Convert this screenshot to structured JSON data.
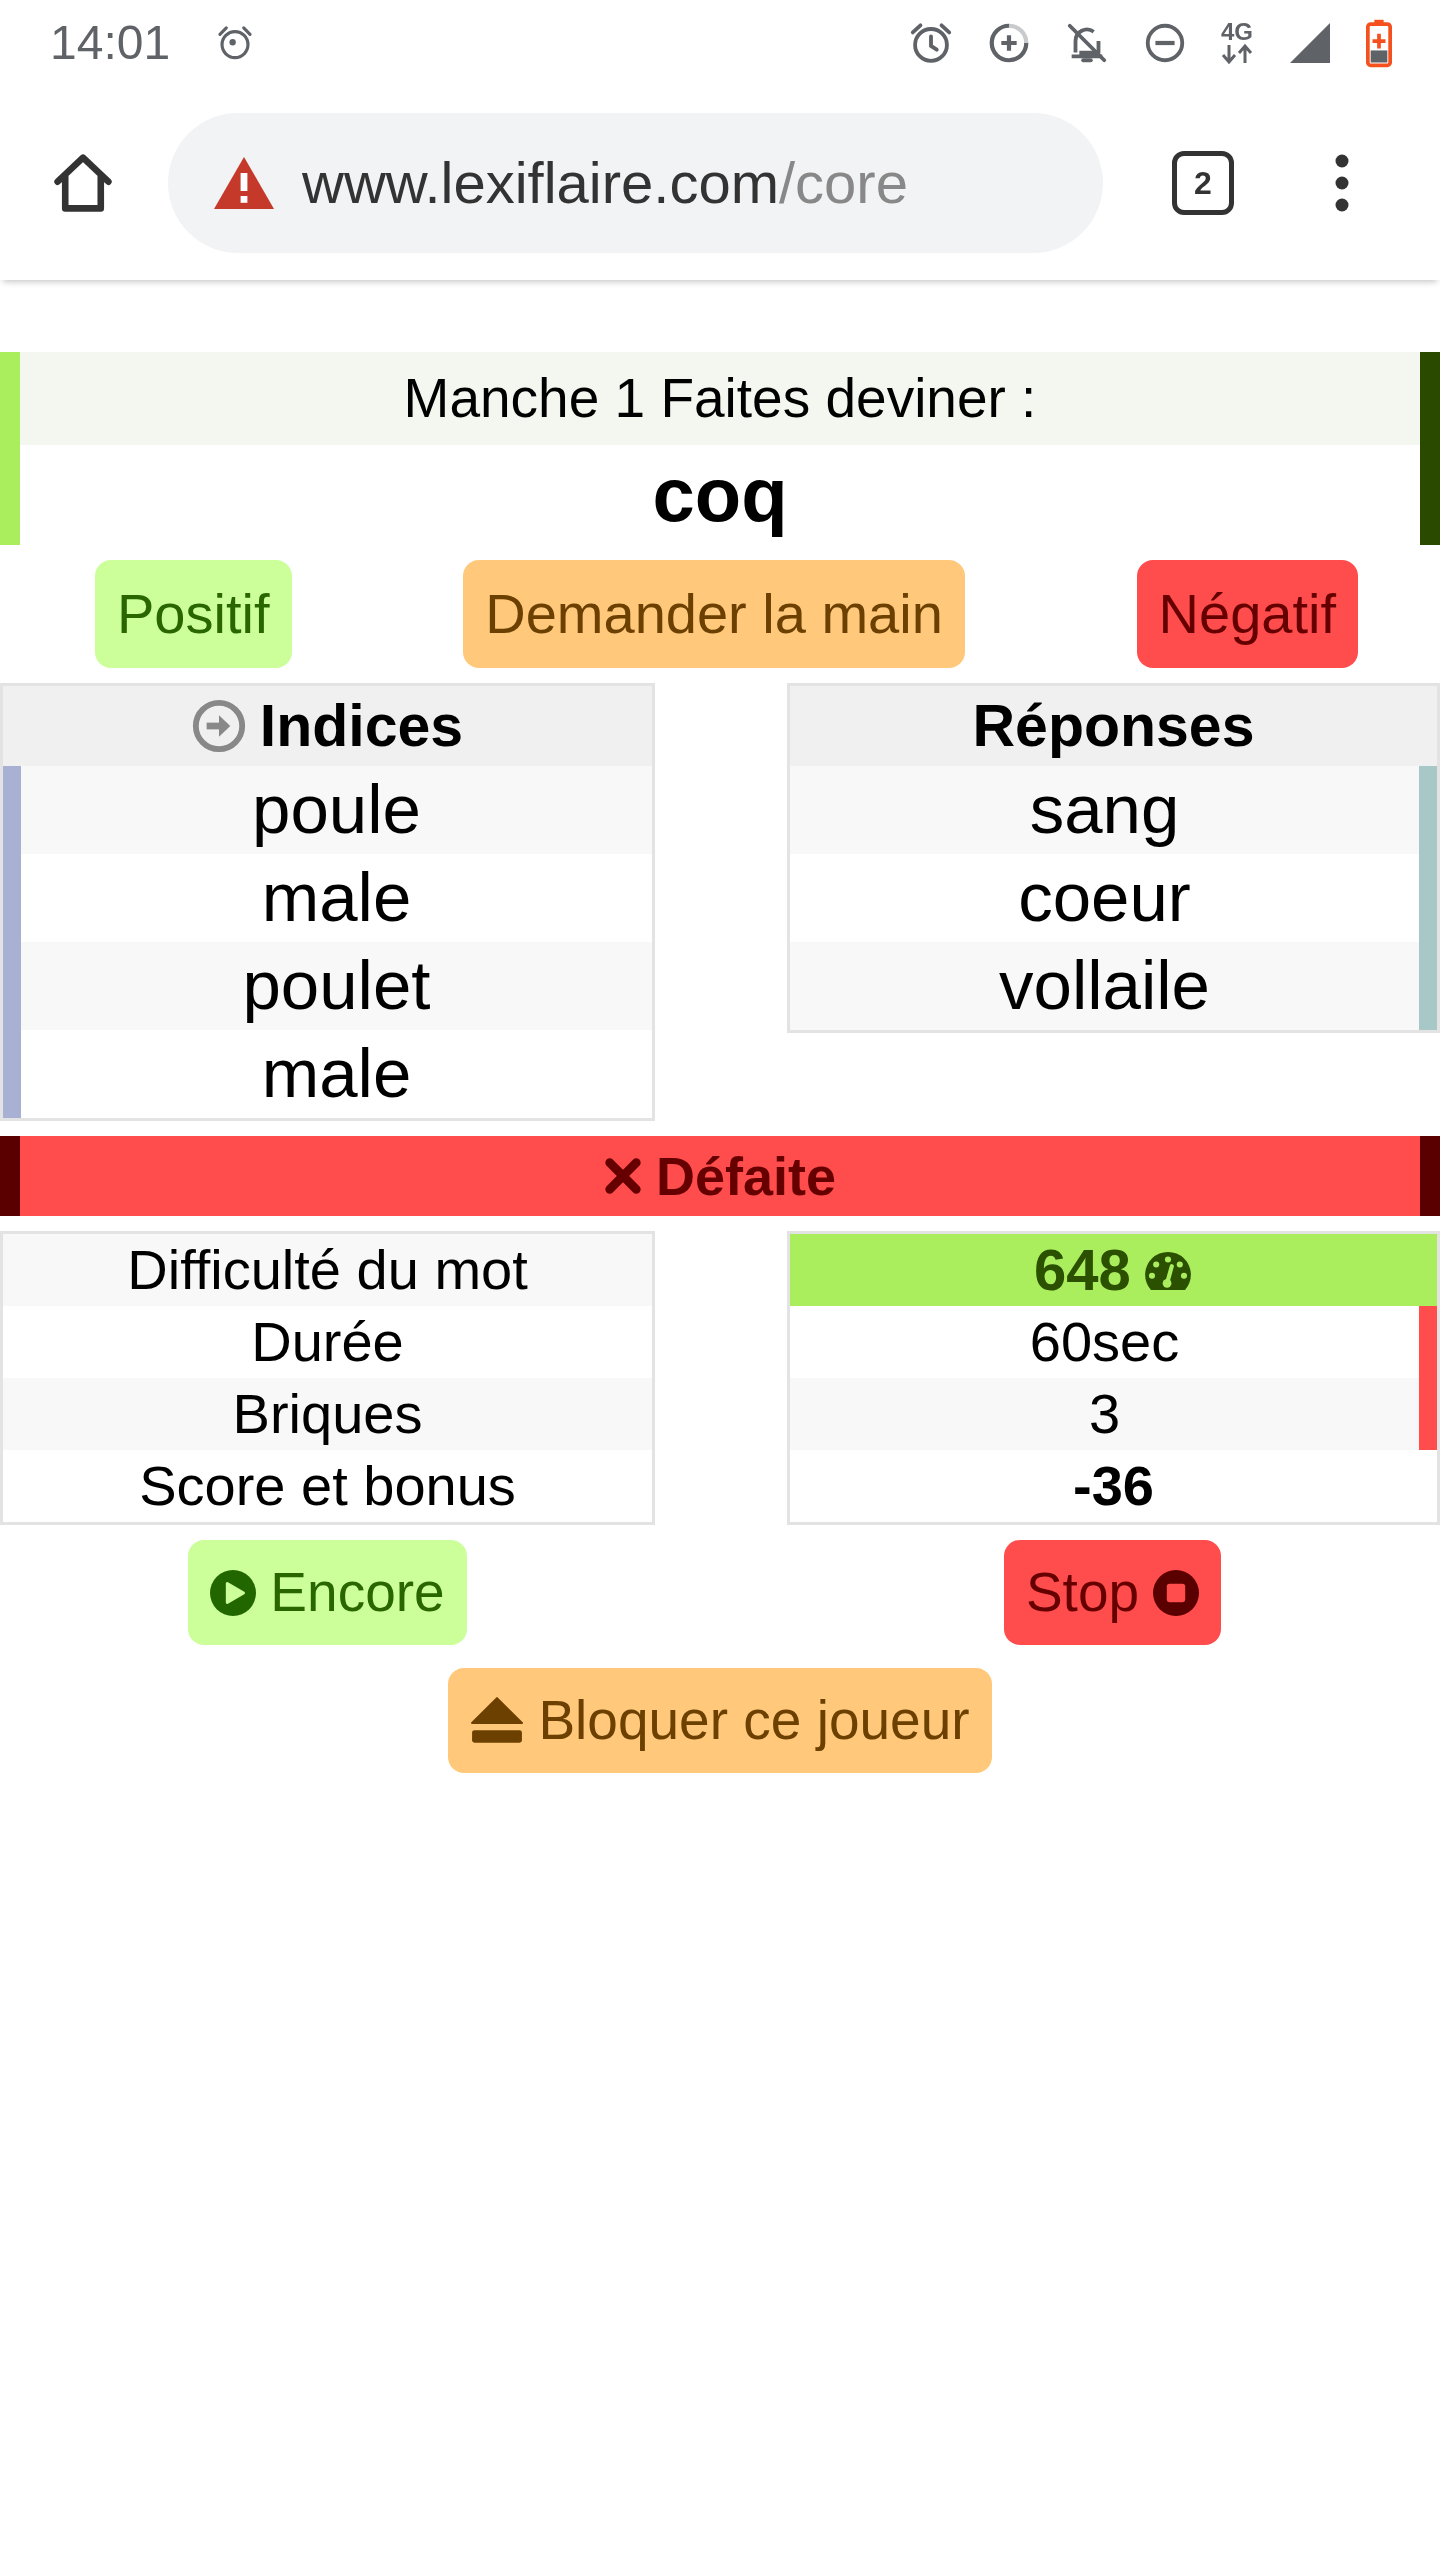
{
  "status_bar": {
    "time": "14:01",
    "network_type": "4G"
  },
  "browser": {
    "url_host": "www.lexiflaire.com",
    "url_path": "/core",
    "tab_count": "2"
  },
  "round": {
    "title": "Manche 1 Faites deviner :",
    "word": "coq"
  },
  "actions": [
    {
      "kind": "positive",
      "label": "Positif"
    },
    {
      "kind": "ask",
      "label": "Demander la main"
    },
    {
      "kind": "negative",
      "label": "Négatif"
    }
  ],
  "panels": [
    {
      "kind": "clues",
      "title": "Indices",
      "rows": [
        "poule",
        "male",
        "poulet",
        "male"
      ]
    },
    {
      "kind": "answers",
      "title": "Réponses",
      "rows": [
        "sang",
        "coeur",
        "vollaile"
      ]
    }
  ],
  "result": {
    "kind": "defeat",
    "label": "Défaite"
  },
  "stats": [
    {
      "kind": "difficulty",
      "label": "Difficulté du mot",
      "value": "648",
      "flagged": false
    },
    {
      "kind": "plain",
      "label": "Durée",
      "value": "60sec",
      "flagged": true
    },
    {
      "kind": "plain",
      "label": "Briques",
      "value": "3",
      "flagged": true
    },
    {
      "kind": "score",
      "label": "Score et bonus",
      "value": "-36",
      "flagged": false
    }
  ],
  "buttons": [
    {
      "kind": "replay",
      "label": "Encore"
    },
    {
      "kind": "stop",
      "label": "Stop"
    },
    {
      "kind": "block",
      "label": "Bloquer ce joueur"
    }
  ]
}
